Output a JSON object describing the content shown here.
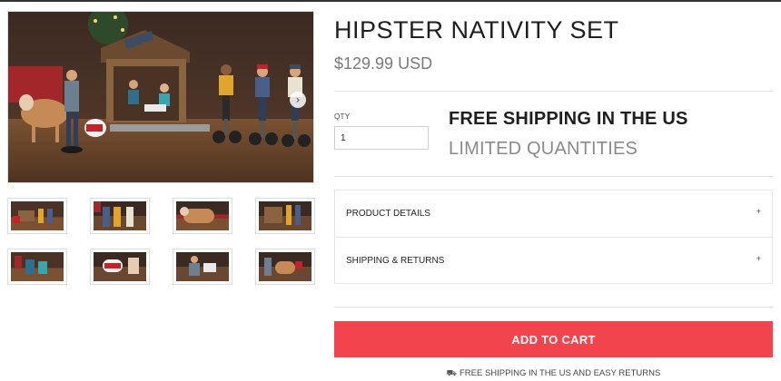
{
  "product": {
    "title": "HIPSTER NATIVITY SET",
    "price": "$129.99 USD"
  },
  "quantity": {
    "label": "QTY",
    "value": "1"
  },
  "shipping_banner": {
    "headline": "FREE SHIPPING IN THE US",
    "subline": "LIMITED QUANTITIES"
  },
  "accordion": [
    {
      "label": "PRODUCT DETAILS",
      "toggle": "+"
    },
    {
      "label": "SHIPPING & RETURNS",
      "toggle": "+"
    }
  ],
  "cart": {
    "button_label": "ADD TO CART",
    "footer_note": "FREE SHIPPING IN THE US AND EASY RETURNS",
    "footer_icon": "truck-icon"
  },
  "gallery": {
    "next_arrow": "›",
    "thumbnail_count": 8
  },
  "colors": {
    "accent": "#f2444c",
    "title": "#1f1f1f",
    "muted": "#7a7a7a"
  }
}
